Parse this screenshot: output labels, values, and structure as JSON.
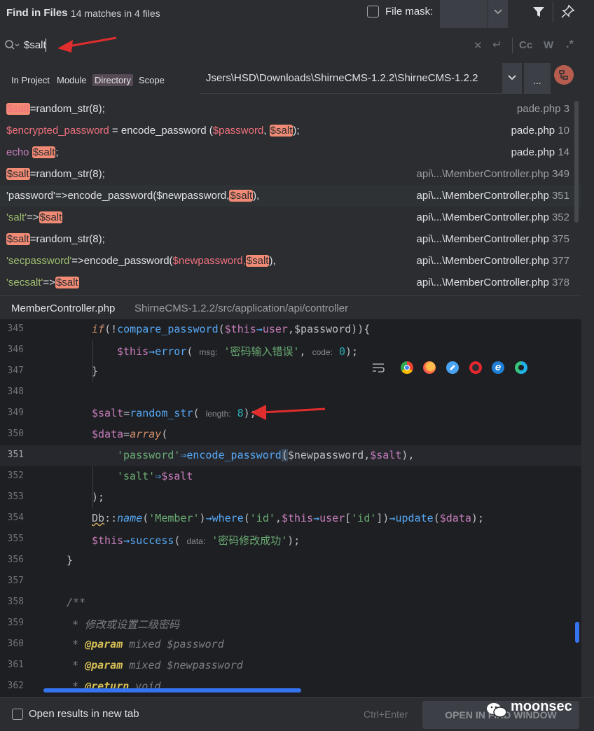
{
  "header": {
    "title": "Find in Files",
    "count": "14 matches in 4 files",
    "file_mask_label": "File mask:"
  },
  "search": {
    "query": "$salt"
  },
  "scope": {
    "tabs": [
      "In Project",
      "Module",
      "Directory",
      "Scope"
    ],
    "selected": "Directory",
    "path": "Jsers\\HSD\\Downloads\\ShirneCMS-1.2.2\\ShirneCMS-1.2.2",
    "more": "..."
  },
  "results": [
    {
      "file": "pade.php",
      "line": "3"
    },
    {
      "file": "pade.php",
      "line": "10"
    },
    {
      "file": "pade.php",
      "line": "14"
    },
    {
      "file": "api\\...\\MemberController.php",
      "line": "349"
    },
    {
      "file": "api\\...\\MemberController.php",
      "line": "351"
    },
    {
      "file": "api\\...\\MemberController.php",
      "line": "352"
    },
    {
      "file": "api\\...\\MemberController.php",
      "line": "375"
    },
    {
      "file": "api\\...\\MemberController.php",
      "line": "377"
    },
    {
      "file": "api\\...\\MemberController.php",
      "line": "378"
    }
  ],
  "result_code": {
    "r0": {
      "a": "$salt",
      "b": "=random_str(8);"
    },
    "r1": {
      "a": "$encrypted_password",
      "b": " = encode_password (",
      "c": "$password",
      "d": ", ",
      "e": "$salt",
      "f": ");"
    },
    "r2": {
      "a": "echo ",
      "b": "$salt",
      "c": ";"
    },
    "r3": {
      "a": "$salt",
      "b": "=random_str(8);"
    },
    "r4": {
      "a": "'password'",
      "b": "=>encode_password($newpassword,",
      "c": "$salt",
      "d": "),"
    },
    "r5": {
      "a": "'salt'",
      "b": "=>",
      "c": "$salt"
    },
    "r6": {
      "a": "$salt",
      "b": "=random_str(8);"
    },
    "r7": {
      "a": "'secpassword'",
      "b": "=>encode_password(",
      "c": "$newpassword,",
      "d": "$salt",
      "e": "),"
    },
    "r8": {
      "a": "'secsalt'",
      "b": "=>",
      "c": "$salt"
    }
  },
  "preview": {
    "file": "MemberController.php",
    "path": "ShirneCMS-1.2.2/src/application/api/controller"
  },
  "editor": {
    "line_numbers": [
      "345",
      "346",
      "347",
      "348",
      "349",
      "350",
      "351",
      "352",
      "353",
      "354",
      "355",
      "356",
      "357",
      "358",
      "359",
      "360",
      "361",
      "362"
    ],
    "l345": {
      "a": "if",
      "b": "(!",
      "c": "compare_password",
      "d": "(",
      "e": "$this",
      "f": "→",
      "g": "user",
      "h": ",$password)){"
    },
    "l346": {
      "a": "$this",
      "b": "→",
      "c": "error",
      "d": "( ",
      "e": "msg:",
      "f": " '密码输入错误'",
      "g": ", ",
      "h": "code:",
      "i": " 0",
      "j": ");"
    },
    "l347": {
      "a": "}"
    },
    "l349": {
      "a": "$salt",
      "b": "=",
      "c": "random_str",
      "d": "( ",
      "e": "length:",
      "f": " 8",
      "g": ");"
    },
    "l350": {
      "a": "$data",
      "b": "=",
      "c": "array",
      "d": "("
    },
    "l351": {
      "a": "'password'",
      "b": "⇒",
      "c": "encode_password",
      "d": "(",
      "e": "$newpassword,",
      "f": "$salt",
      "g": "),"
    },
    "l352": {
      "a": "'salt'",
      "b": "⇒",
      "c": "$salt"
    },
    "l353": {
      "a": ");"
    },
    "l354": {
      "a": "Db",
      "b": "::",
      "c": "name",
      "d": "(",
      "e": "'Member'",
      "f": ")",
      "g": "→",
      "h": "where",
      "i": "(",
      "j": "'id'",
      "k": ",",
      "l": "$this",
      "m": "→",
      "n": "user",
      "o": "[",
      "p": "'id'",
      "q": "])",
      "r": "→",
      "s": "update",
      "t": "(",
      "u": "$data",
      "v": ");"
    },
    "l355": {
      "a": "$this",
      "b": "→",
      "c": "success",
      "d": "( ",
      "e": "data:",
      "f": " '密码修改成功'",
      "g": ");"
    },
    "l356": {
      "a": "}"
    },
    "l358": {
      "a": "/**"
    },
    "l359": {
      "a": "* 修改或设置二级密码"
    },
    "l360": {
      "a": "* ",
      "b": "@param",
      "c": " mixed ",
      "d": "$password"
    },
    "l361": {
      "a": "* ",
      "b": "@param",
      "c": " mixed ",
      "d": "$newpassword"
    },
    "l362": {
      "a": "* ",
      "b": "@return",
      "c": " void"
    }
  },
  "footer": {
    "checkbox_label": "Open results in new tab",
    "shortcut": "Ctrl+Enter",
    "button": "OPEN IN FIND WINDOW",
    "watermark": "moonsec"
  },
  "colors": {
    "highlight": "#f28b75",
    "accent": "#3574f0",
    "arrow": "#e02d2d"
  }
}
